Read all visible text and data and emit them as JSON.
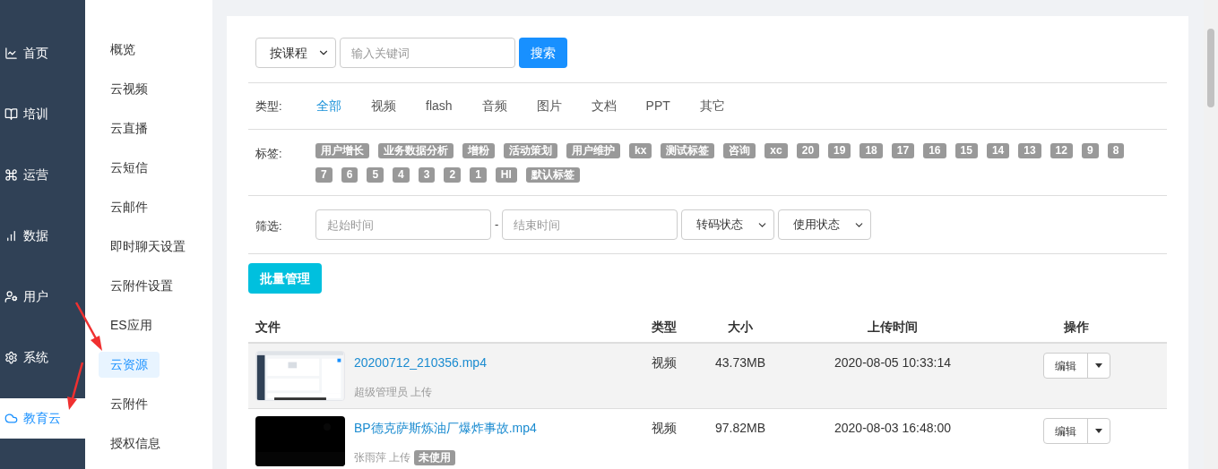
{
  "main_nav": [
    {
      "label": "首页",
      "selected": false
    },
    {
      "label": "培训",
      "selected": false
    },
    {
      "label": "运营",
      "selected": false
    },
    {
      "label": "数据",
      "selected": false
    },
    {
      "label": "用户",
      "selected": false
    },
    {
      "label": "系统",
      "selected": false
    },
    {
      "label": "教育云",
      "selected": true
    }
  ],
  "sub_nav": [
    {
      "label": "概览",
      "selected": false
    },
    {
      "label": "云视频",
      "selected": false
    },
    {
      "label": "云直播",
      "selected": false
    },
    {
      "label": "云短信",
      "selected": false
    },
    {
      "label": "云邮件",
      "selected": false
    },
    {
      "label": "即时聊天设置",
      "selected": false
    },
    {
      "label": "云附件设置",
      "selected": false
    },
    {
      "label": "ES应用",
      "selected": false
    },
    {
      "label": "云资源",
      "selected": true
    },
    {
      "label": "云附件",
      "selected": false
    },
    {
      "label": "授权信息",
      "selected": false
    }
  ],
  "search": {
    "scope": "按课程",
    "placeholder": "输入关键词",
    "button": "搜索"
  },
  "type_filter": {
    "label": "类型:",
    "options": [
      {
        "label": "全部",
        "selected": true
      },
      {
        "label": "视频",
        "selected": false
      },
      {
        "label": "flash",
        "selected": false
      },
      {
        "label": "音频",
        "selected": false
      },
      {
        "label": "图片",
        "selected": false
      },
      {
        "label": "文档",
        "selected": false
      },
      {
        "label": "PPT",
        "selected": false
      },
      {
        "label": "其它",
        "selected": false
      }
    ]
  },
  "tag_filter": {
    "label": "标签:",
    "tags": [
      "用户增长",
      "业务数据分析",
      "增粉",
      "活动策划",
      "用户维护",
      "kx",
      "测试标签",
      "咨询",
      "xc",
      "20",
      "19",
      "18",
      "17",
      "16",
      "15",
      "14",
      "13",
      "12",
      "9",
      "8",
      "7",
      "6",
      "5",
      "4",
      "3",
      "2",
      "1",
      "HI",
      "默认标签"
    ]
  },
  "screen_filter": {
    "label": "筛选:",
    "start_placeholder": "起始时间",
    "separator": "-",
    "end_placeholder": "结束时间",
    "selects": [
      "转码状态",
      "使用状态"
    ]
  },
  "batch_button": "批量管理",
  "table": {
    "columns": [
      "文件",
      "类型",
      "大小",
      "上传时间",
      "操作"
    ],
    "rows": [
      {
        "name": "20200712_210356.mp4",
        "uploader": "超级管理员 上传",
        "type": "视频",
        "size": "43.73MB",
        "uploaded": "2020-08-05 10:33:14",
        "action": "编辑",
        "highlighted": true
      },
      {
        "name": "BP德克萨斯炼油厂爆炸事故.mp4",
        "uploader": "张雨萍 上传",
        "badge": "未使用",
        "type": "视频",
        "size": "97.82MB",
        "uploaded": "2020-08-03 16:48:00",
        "action": "编辑",
        "highlighted": false
      }
    ]
  }
}
